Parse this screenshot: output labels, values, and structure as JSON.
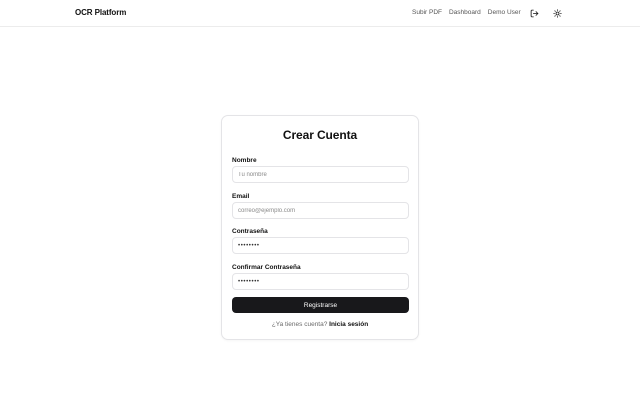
{
  "navbar": {
    "brand": "OCR Platform",
    "links": {
      "upload": "Subir PDF",
      "dashboard": "Dashboard"
    },
    "user_name": "Demo User",
    "icons": {
      "logout": "logout-icon",
      "theme": "sun-icon"
    }
  },
  "form": {
    "title": "Crear Cuenta",
    "name": {
      "label": "Nombre",
      "placeholder": "Tu nombre",
      "value": ""
    },
    "email": {
      "label": "Email",
      "placeholder": "correo@ejemplo.com",
      "value": ""
    },
    "password": {
      "label": "Contraseña",
      "value": "••••••••"
    },
    "confirm_password": {
      "label": "Confirmar Contraseña",
      "value": "••••••••"
    },
    "submit_label": "Registrarse",
    "footer_text": "¿Ya tienes cuenta?",
    "footer_link": "Inicia sesión"
  },
  "colors": {
    "primary_button": "#18181b",
    "border": "#e4e4e7",
    "muted_text": "#6b6b6b"
  }
}
